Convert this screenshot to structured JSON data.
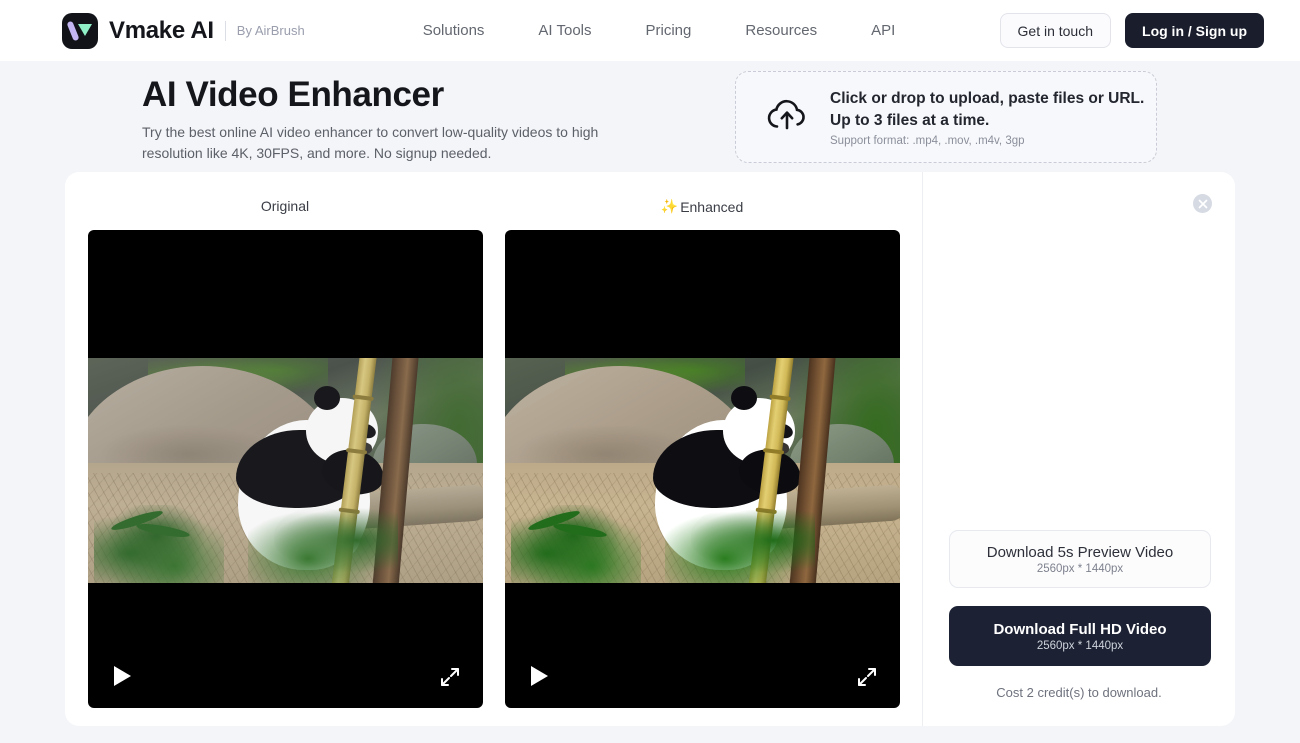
{
  "header": {
    "brand_name": "Vmake AI",
    "brand_by": "By AirBrush",
    "logo_icon": "vmake-logo-icon",
    "nav": [
      {
        "label": "Solutions"
      },
      {
        "label": "AI Tools"
      },
      {
        "label": "Pricing"
      },
      {
        "label": "Resources"
      },
      {
        "label": "API"
      }
    ],
    "get_in_touch": "Get in touch",
    "login_signup": "Log in / Sign up"
  },
  "hero": {
    "title": "AI Video Enhancer",
    "subtitle": "Try the best online AI video enhancer to convert low-quality videos to high resolution like 4K, 30FPS, and more. No signup needed."
  },
  "upload": {
    "icon": "cloud-upload-icon",
    "line1": "Click or drop to upload, paste files or URL.",
    "line2": "Up to 3 files at a time.",
    "support": "Support format: .mp4, .mov, .m4v, 3gp"
  },
  "compare": {
    "original_label": "Original",
    "enhanced_label": "Enhanced",
    "enhanced_icon": "sparkles-icon",
    "enhanced_sparkle": "✨",
    "play_icon": "play-icon",
    "fullscreen_icon": "fullscreen-expand-icon",
    "scene_description": "Giant panda eating bamboo beside a rock and tree trunk"
  },
  "result_panel": {
    "close_icon": "close-icon",
    "close_glyph": "✕",
    "preview_button": {
      "label": "Download 5s Preview Video",
      "resolution": "2560px * 1440px"
    },
    "full_button": {
      "label": "Download Full HD Video",
      "resolution": "2560px * 1440px"
    },
    "cost_note": "Cost 2 credit(s) to download."
  },
  "colors": {
    "page_bg": "#f4f5f9",
    "card_bg": "#ffffff",
    "accent_dark": "#1c2233",
    "text_primary": "#14161c",
    "text_muted": "#63676f",
    "logo_purple": "#c3b6f2",
    "logo_mint": "#90f0c8"
  }
}
